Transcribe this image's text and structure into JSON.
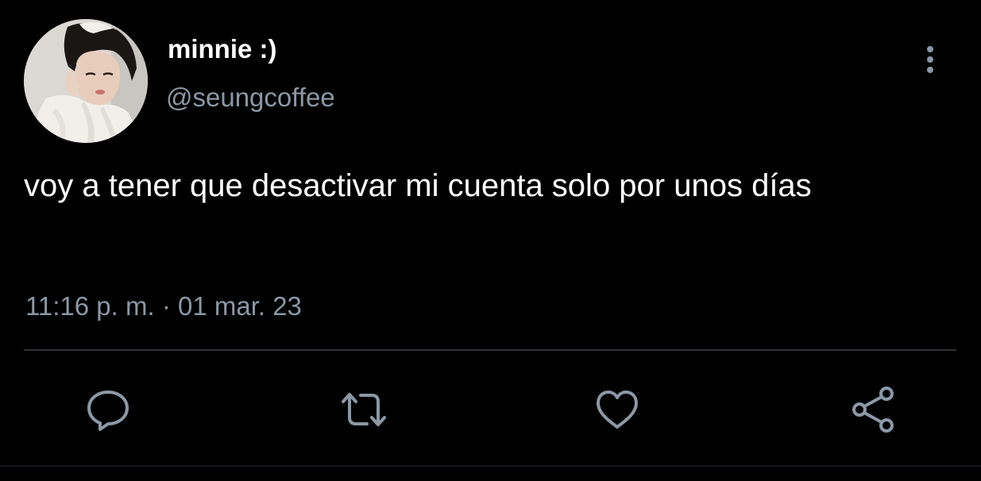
{
  "tweet": {
    "author": {
      "display_name": "minnie :)",
      "handle": "@seungcoffee"
    },
    "text": "voy a tener que desactivar mi cuenta solo por unos días",
    "timestamp": "11:16 p. m. · 01 mar. 23"
  },
  "icons": {
    "more": "more-vertical-icon",
    "reply": "reply-icon",
    "retweet": "retweet-icon",
    "like": "heart-icon",
    "share": "share-icon"
  },
  "colors": {
    "background": "#000000",
    "primary_text": "#ffffff",
    "secondary_text": "#8b98a5",
    "divider": "#2f3336"
  }
}
